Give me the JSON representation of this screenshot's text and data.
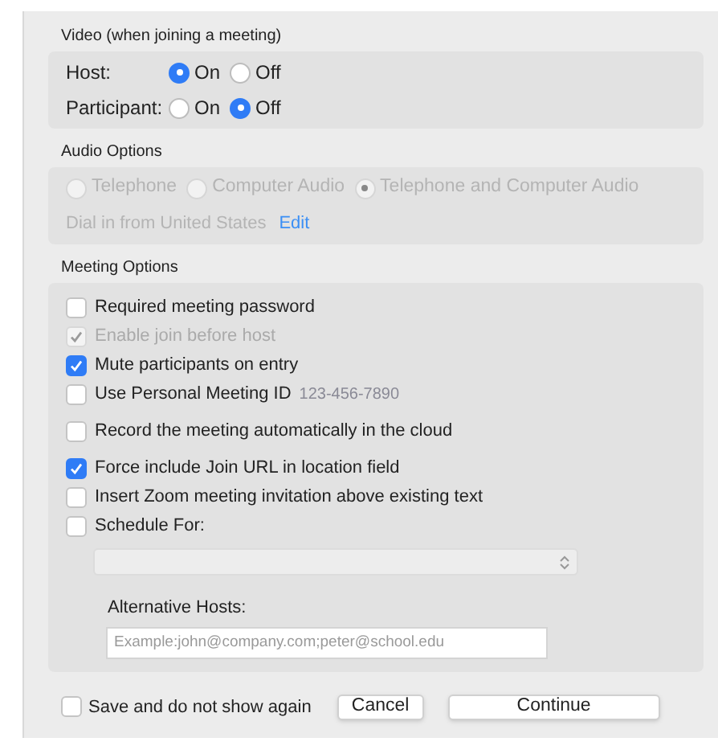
{
  "video": {
    "title": "Video (when joining a meeting)",
    "rows": [
      {
        "label": "Host:",
        "options": [
          {
            "label": "On",
            "selected": true
          },
          {
            "label": "Off",
            "selected": false
          }
        ]
      },
      {
        "label": "Participant:",
        "options": [
          {
            "label": "On",
            "selected": false
          },
          {
            "label": "Off",
            "selected": true
          }
        ]
      }
    ]
  },
  "audio": {
    "title": "Audio Options",
    "disabled": true,
    "options": [
      {
        "label": "Telephone",
        "selected": false
      },
      {
        "label": "Computer Audio",
        "selected": false
      },
      {
        "label": "Telephone and Computer Audio",
        "selected": true
      }
    ],
    "dial_in": "Dial in from United States",
    "edit_link": "Edit"
  },
  "meeting": {
    "title": "Meeting Options",
    "options": [
      {
        "label": "Required meeting password",
        "checked": false,
        "disabled": false
      },
      {
        "label": "Enable join before host",
        "checked": true,
        "disabled": true
      },
      {
        "label": "Mute participants on entry",
        "checked": true,
        "disabled": false
      },
      {
        "label": "Use Personal Meeting ID",
        "checked": false,
        "disabled": false,
        "value": "123-456-7890"
      },
      {
        "label": "Record the meeting automatically in the cloud",
        "checked": false,
        "disabled": false
      },
      {
        "label": "Force include Join URL in location field",
        "checked": true,
        "disabled": false
      },
      {
        "label": "Insert Zoom meeting invitation above existing text",
        "checked": false,
        "disabled": false
      },
      {
        "label": "Schedule For:",
        "checked": false,
        "disabled": false
      }
    ],
    "alt_hosts_label": "Alternative Hosts:",
    "alt_hosts_placeholder": "Example:john@company.com;peter@school.edu"
  },
  "footer": {
    "save_label": "Save and do not show again",
    "save_checked": false,
    "buttons": [
      "Cancel",
      "Continue"
    ]
  }
}
